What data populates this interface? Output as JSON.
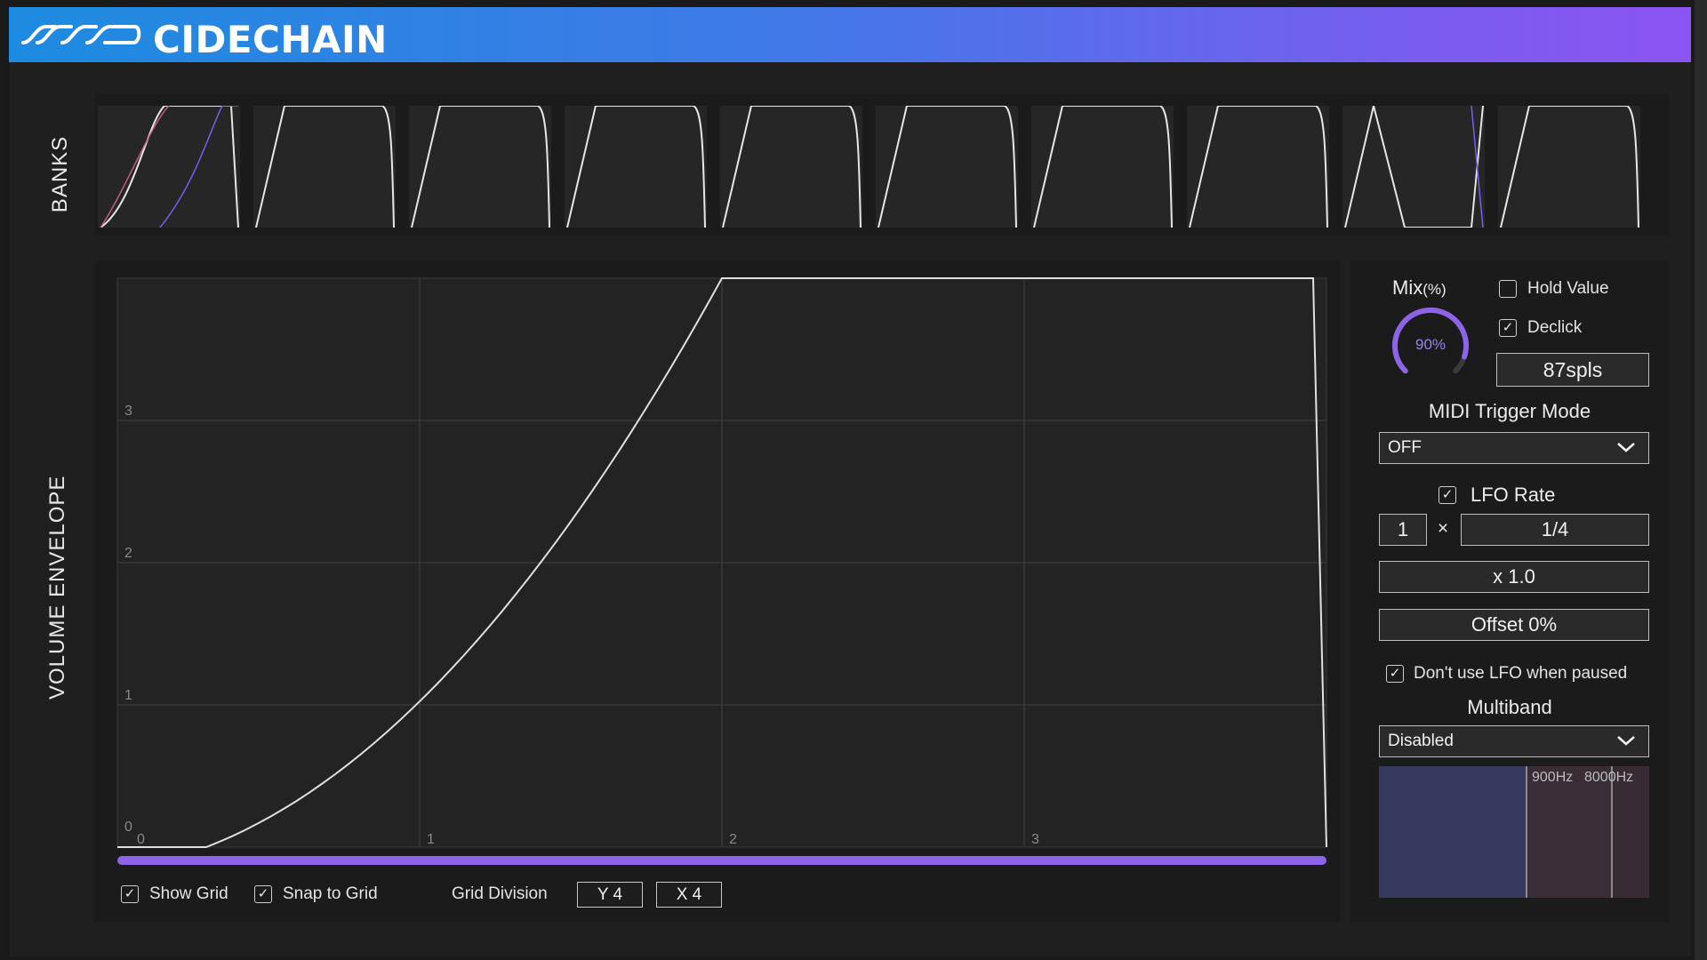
{
  "header": {
    "title": "CIDECHAIN"
  },
  "side_labels": {
    "banks": "BANKS",
    "volume_envelope": "VOLUME ENVELOPE"
  },
  "banks": {
    "count": 10,
    "selected_index": 0
  },
  "envelope": {
    "y_ticks": [
      "0",
      "1",
      "2",
      "3"
    ],
    "x_ticks": [
      "0",
      "1",
      "2",
      "3"
    ],
    "curve_color": "#e0e0e0",
    "scrollbar_color": "#8d63e8"
  },
  "bottom_controls": {
    "show_grid_label": "Show Grid",
    "show_grid_checked": true,
    "snap_to_grid_label": "Snap to Grid",
    "snap_to_grid_checked": true,
    "grid_division_label": "Grid Division",
    "y_division": "Y 4",
    "x_division": "X 4"
  },
  "right_panel": {
    "mix_label": "Mix",
    "mix_unit": "(%)",
    "mix_value_text": "90%",
    "mix_fraction": 0.9,
    "hold_value_label": "Hold Value",
    "hold_value_checked": false,
    "declick_label": "Declick",
    "declick_checked": true,
    "declick_samples": "87spls",
    "midi_trigger_mode_label": "MIDI Trigger Mode",
    "midi_trigger_mode_value": "OFF",
    "lfo_rate_label": "LFO Rate",
    "lfo_rate_checked": true,
    "lfo_multiplier": "1",
    "lfo_times_symbol": "×",
    "lfo_division": "1/4",
    "lfo_scale": "x 1.0",
    "offset": "Offset 0%",
    "dont_use_lfo_label": "Don't use LFO when paused",
    "dont_use_lfo_checked": true,
    "multiband_label": "Multiband",
    "multiband_value": "Disabled",
    "band_low_freq": "900Hz",
    "band_high_freq": "8000Hz"
  },
  "colors": {
    "accent": "#8d63e8",
    "checkmark": "✓"
  }
}
